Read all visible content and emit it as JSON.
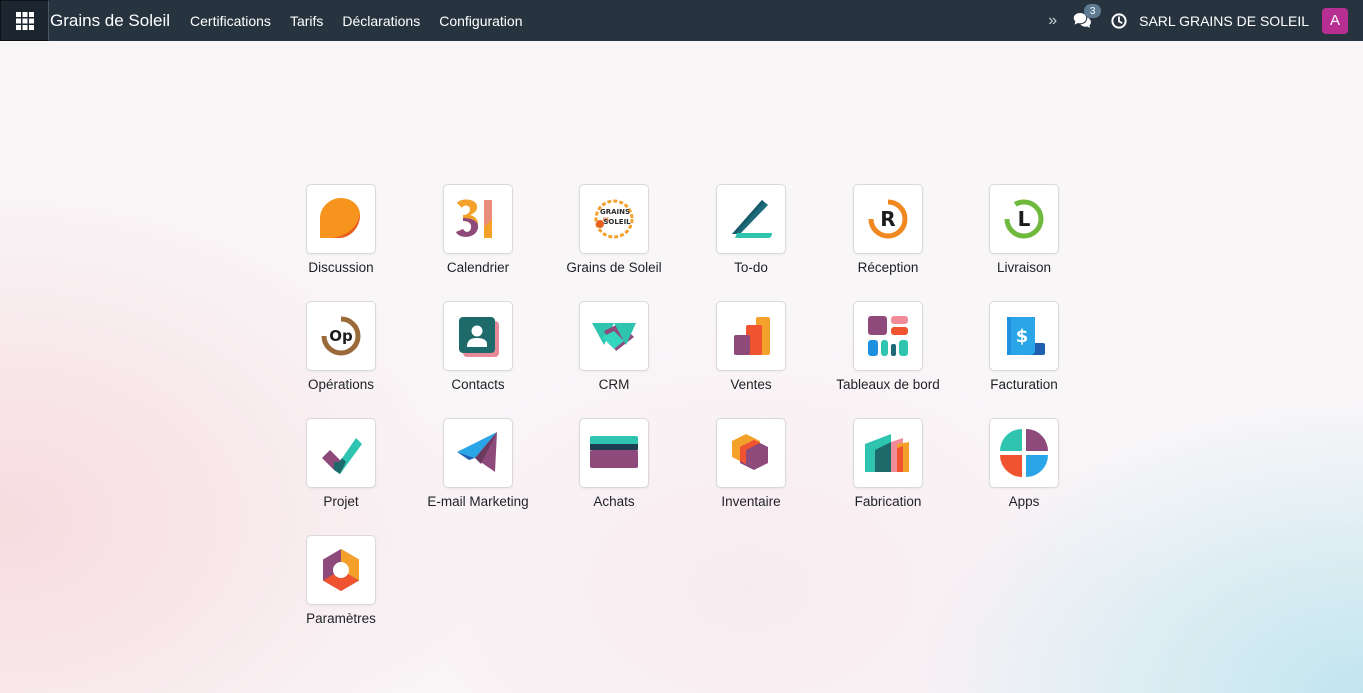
{
  "navbar": {
    "brand": "Grains de Soleil",
    "menu": [
      "Certifications",
      "Tarifs",
      "Déclarations",
      "Configuration"
    ],
    "chat_count": "3",
    "company": "SARL GRAINS DE SOLEIL",
    "avatar_letter": "A",
    "icons": [
      "apps-grid-icon",
      "chevrons-right-icon",
      "chat-icon",
      "clock-icon"
    ]
  },
  "apps": [
    {
      "label": "Discussion",
      "icon": "discussion-icon"
    },
    {
      "label": "Calendrier",
      "icon": "calendar-icon"
    },
    {
      "label": "Grains de Soleil",
      "icon": "grains-de-soleil-logo-icon",
      "logo_text": [
        "GRAINS",
        "DE",
        "SOLEIL"
      ]
    },
    {
      "label": "To-do",
      "icon": "todo-icon"
    },
    {
      "label": "Réception",
      "icon": "reception-icon",
      "glyph": "R"
    },
    {
      "label": "Livraison",
      "icon": "livraison-icon",
      "glyph": "L"
    },
    {
      "label": "Opérations",
      "icon": "operations-icon",
      "glyph": "Op"
    },
    {
      "label": "Contacts",
      "icon": "contacts-icon"
    },
    {
      "label": "CRM",
      "icon": "crm-icon"
    },
    {
      "label": "Ventes",
      "icon": "sales-icon"
    },
    {
      "label": "Tableaux de bord",
      "icon": "dashboards-icon"
    },
    {
      "label": "Facturation",
      "icon": "invoicing-icon",
      "glyph": "$"
    },
    {
      "label": "Projet",
      "icon": "project-icon"
    },
    {
      "label": "E-mail Marketing",
      "icon": "email-marketing-icon"
    },
    {
      "label": "Achats",
      "icon": "purchase-icon"
    },
    {
      "label": "Inventaire",
      "icon": "inventory-icon"
    },
    {
      "label": "Fabrication",
      "icon": "manufacturing-icon"
    },
    {
      "label": "Apps",
      "icon": "apps-icon"
    },
    {
      "label": "Paramètres",
      "icon": "settings-icon"
    }
  ],
  "colors": {
    "navbar_bg": "#273440",
    "avatar_bg": "#b82f93",
    "badge_bg": "#5f7b91"
  }
}
